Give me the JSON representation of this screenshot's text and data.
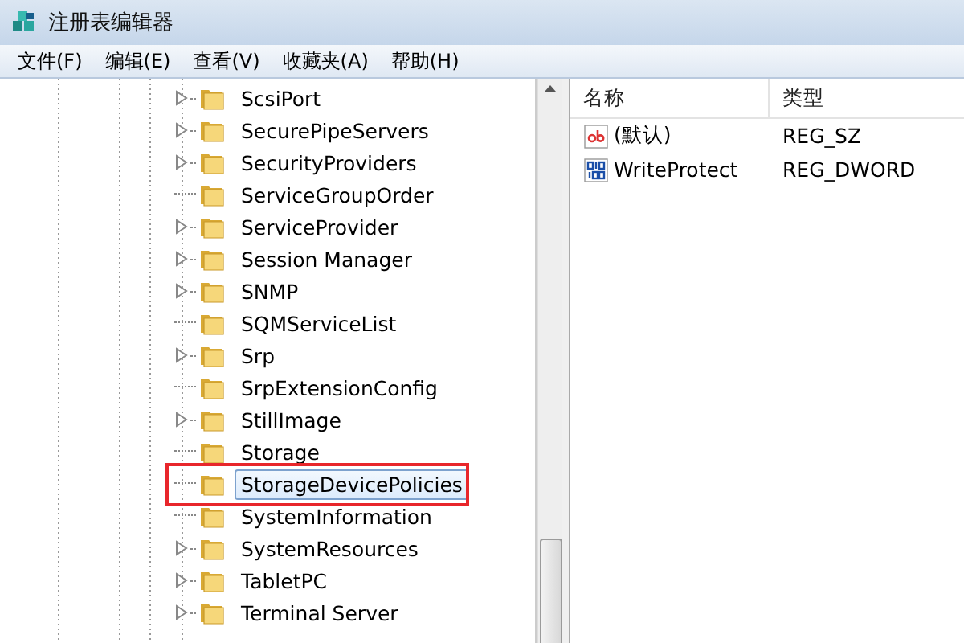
{
  "window": {
    "title": "注册表编辑器"
  },
  "menu": [
    "文件(F)",
    "编辑(E)",
    "查看(V)",
    "收藏夹(A)",
    "帮助(H)"
  ],
  "tree": {
    "items": [
      {
        "label": "ScsiPort",
        "expandable": true,
        "selected": false,
        "highlighted": false
      },
      {
        "label": "SecurePipeServers",
        "expandable": true,
        "selected": false,
        "highlighted": false
      },
      {
        "label": "SecurityProviders",
        "expandable": true,
        "selected": false,
        "highlighted": false
      },
      {
        "label": "ServiceGroupOrder",
        "expandable": false,
        "selected": false,
        "highlighted": false
      },
      {
        "label": "ServiceProvider",
        "expandable": true,
        "selected": false,
        "highlighted": false
      },
      {
        "label": "Session Manager",
        "expandable": true,
        "selected": false,
        "highlighted": false
      },
      {
        "label": "SNMP",
        "expandable": true,
        "selected": false,
        "highlighted": false
      },
      {
        "label": "SQMServiceList",
        "expandable": false,
        "selected": false,
        "highlighted": false
      },
      {
        "label": "Srp",
        "expandable": true,
        "selected": false,
        "highlighted": false
      },
      {
        "label": "SrpExtensionConfig",
        "expandable": false,
        "selected": false,
        "highlighted": false
      },
      {
        "label": "StillImage",
        "expandable": true,
        "selected": false,
        "highlighted": false
      },
      {
        "label": "Storage",
        "expandable": false,
        "selected": false,
        "highlighted": false
      },
      {
        "label": "StorageDevicePolicies",
        "expandable": false,
        "selected": true,
        "highlighted": true
      },
      {
        "label": "SystemInformation",
        "expandable": false,
        "selected": false,
        "highlighted": false
      },
      {
        "label": "SystemResources",
        "expandable": true,
        "selected": false,
        "highlighted": false
      },
      {
        "label": "TabletPC",
        "expandable": true,
        "selected": false,
        "highlighted": false
      },
      {
        "label": "Terminal Server",
        "expandable": true,
        "selected": false,
        "highlighted": false
      }
    ]
  },
  "values": {
    "columns": [
      "名称",
      "类型"
    ],
    "rows": [
      {
        "kind": "string",
        "name": "(默认)",
        "type": "REG_SZ"
      },
      {
        "kind": "dword",
        "name": "WriteProtect",
        "type": "REG_DWORD"
      }
    ]
  }
}
